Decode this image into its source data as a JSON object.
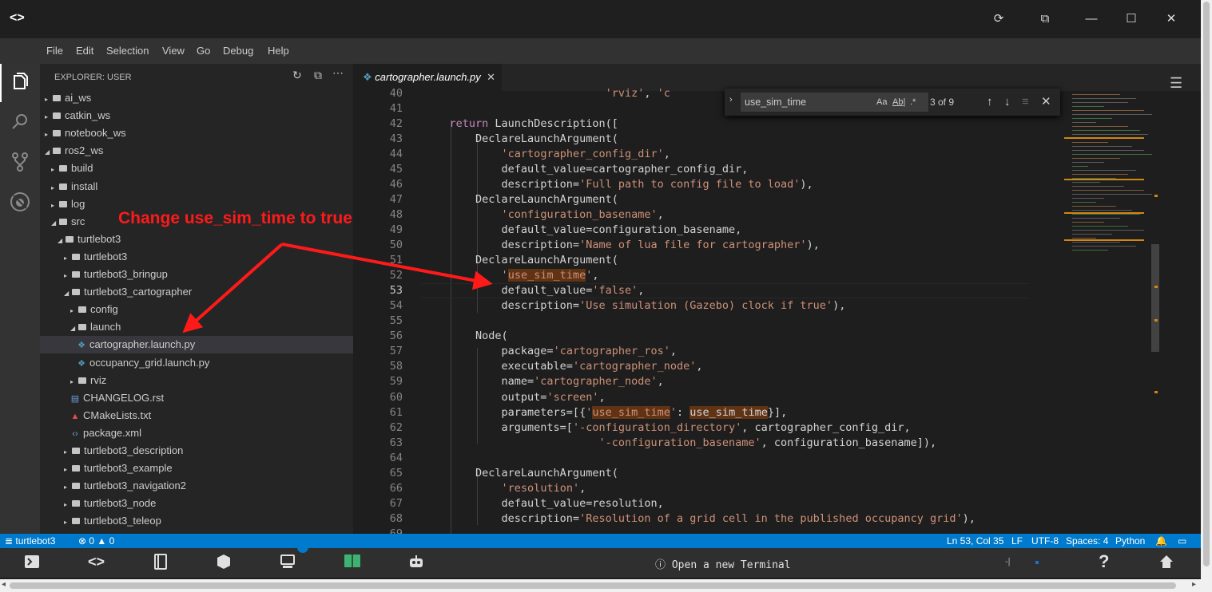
{
  "window": {
    "logo": "<>",
    "controls": [
      "⟳",
      "⧉",
      "—",
      "☐",
      "✕"
    ]
  },
  "menu": [
    "File",
    "Edit",
    "Selection",
    "View",
    "Go",
    "Debug",
    "Help"
  ],
  "sidebar": {
    "title": "EXPLORER: USER",
    "tree": [
      {
        "label": "ai_ws",
        "type": "folder",
        "depth": 0,
        "open": false
      },
      {
        "label": "catkin_ws",
        "type": "folder",
        "depth": 0,
        "open": false
      },
      {
        "label": "notebook_ws",
        "type": "folder",
        "depth": 0,
        "open": false
      },
      {
        "label": "ros2_ws",
        "type": "folder",
        "depth": 0,
        "open": true
      },
      {
        "label": "build",
        "type": "folder",
        "depth": 1,
        "open": false
      },
      {
        "label": "install",
        "type": "folder",
        "depth": 1,
        "open": false
      },
      {
        "label": "log",
        "type": "folder",
        "depth": 1,
        "open": false
      },
      {
        "label": "src",
        "type": "folder",
        "depth": 1,
        "open": true
      },
      {
        "label": "turtlebot3",
        "type": "folder",
        "depth": 2,
        "open": true
      },
      {
        "label": "turtlebot3",
        "type": "folder",
        "depth": 3,
        "open": false
      },
      {
        "label": "turtlebot3_bringup",
        "type": "folder",
        "depth": 3,
        "open": false
      },
      {
        "label": "turtlebot3_cartographer",
        "type": "folder",
        "depth": 3,
        "open": true
      },
      {
        "label": "config",
        "type": "folder",
        "depth": 4,
        "open": false
      },
      {
        "label": "launch",
        "type": "folder",
        "depth": 4,
        "open": true
      },
      {
        "label": "cartographer.launch.py",
        "type": "python",
        "depth": 5,
        "selected": true
      },
      {
        "label": "occupancy_grid.launch.py",
        "type": "python",
        "depth": 5
      },
      {
        "label": "rviz",
        "type": "folder",
        "depth": 4,
        "open": false
      },
      {
        "label": "CHANGELOG.rst",
        "type": "rst",
        "depth": 4
      },
      {
        "label": "CMakeLists.txt",
        "type": "cmake",
        "depth": 4
      },
      {
        "label": "package.xml",
        "type": "xml",
        "depth": 4
      },
      {
        "label": "turtlebot3_description",
        "type": "folder",
        "depth": 3,
        "open": false
      },
      {
        "label": "turtlebot3_example",
        "type": "folder",
        "depth": 3,
        "open": false
      },
      {
        "label": "turtlebot3_navigation2",
        "type": "folder",
        "depth": 3,
        "open": false
      },
      {
        "label": "turtlebot3_node",
        "type": "folder",
        "depth": 3,
        "open": false
      },
      {
        "label": "turtlebot3_teleop",
        "type": "folder",
        "depth": 3,
        "open": false
      }
    ]
  },
  "editor": {
    "tab": "cartographer.launch.py",
    "find": {
      "query": "use_sim_time",
      "count": "3 of 9"
    },
    "lines": [
      {
        "n": "40",
        "parts": [
          {
            "t": "                            "
          },
          {
            "t": "'rviz'",
            "c": "str"
          },
          {
            "t": ", "
          },
          {
            "t": "'c",
            "c": "str"
          }
        ]
      },
      {
        "n": "41",
        "parts": []
      },
      {
        "n": "42",
        "parts": [
          {
            "t": "    "
          },
          {
            "t": "return",
            "c": "kw"
          },
          {
            "t": " LaunchDescription(["
          }
        ]
      },
      {
        "n": "43",
        "parts": [
          {
            "t": "        DeclareLaunchArgument("
          }
        ]
      },
      {
        "n": "44",
        "parts": [
          {
            "t": "            "
          },
          {
            "t": "'cartographer_config_dir'",
            "c": "str"
          },
          {
            "t": ","
          }
        ]
      },
      {
        "n": "45",
        "parts": [
          {
            "t": "            default_value=cartographer_config_dir,"
          }
        ]
      },
      {
        "n": "46",
        "parts": [
          {
            "t": "            description="
          },
          {
            "t": "'Full path to config file to load'",
            "c": "str"
          },
          {
            "t": "),"
          }
        ]
      },
      {
        "n": "47",
        "parts": [
          {
            "t": "        DeclareLaunchArgument("
          }
        ]
      },
      {
        "n": "48",
        "parts": [
          {
            "t": "            "
          },
          {
            "t": "'configuration_basename'",
            "c": "str"
          },
          {
            "t": ","
          }
        ]
      },
      {
        "n": "49",
        "parts": [
          {
            "t": "            default_value=configuration_basename,"
          }
        ]
      },
      {
        "n": "50",
        "parts": [
          {
            "t": "            description="
          },
          {
            "t": "'Name of lua file for cartographer'",
            "c": "str"
          },
          {
            "t": "),"
          }
        ]
      },
      {
        "n": "51",
        "parts": [
          {
            "t": "        DeclareLaunchArgument("
          }
        ]
      },
      {
        "n": "52",
        "parts": [
          {
            "t": "            "
          },
          {
            "t": "'",
            "c": "str"
          },
          {
            "t": "use_sim_time",
            "c": "str hl"
          },
          {
            "t": "'",
            "c": "str"
          },
          {
            "t": ","
          }
        ]
      },
      {
        "n": "53",
        "parts": [
          {
            "t": "            default_value="
          },
          {
            "t": "'false'",
            "c": "str"
          },
          {
            "t": ","
          }
        ],
        "current": true
      },
      {
        "n": "54",
        "parts": [
          {
            "t": "            description="
          },
          {
            "t": "'Use simulation (Gazebo) clock if true'",
            "c": "str"
          },
          {
            "t": "),"
          }
        ]
      },
      {
        "n": "55",
        "parts": []
      },
      {
        "n": "56",
        "parts": [
          {
            "t": "        Node("
          }
        ]
      },
      {
        "n": "57",
        "parts": [
          {
            "t": "            package="
          },
          {
            "t": "'cartographer_ros'",
            "c": "str"
          },
          {
            "t": ","
          }
        ]
      },
      {
        "n": "58",
        "parts": [
          {
            "t": "            executable="
          },
          {
            "t": "'cartographer_node'",
            "c": "str"
          },
          {
            "t": ","
          }
        ]
      },
      {
        "n": "59",
        "parts": [
          {
            "t": "            name="
          },
          {
            "t": "'cartographer_node'",
            "c": "str"
          },
          {
            "t": ","
          }
        ]
      },
      {
        "n": "60",
        "parts": [
          {
            "t": "            output="
          },
          {
            "t": "'screen'",
            "c": "str"
          },
          {
            "t": ","
          }
        ]
      },
      {
        "n": "61",
        "parts": [
          {
            "t": "            parameters=[{"
          },
          {
            "t": "'",
            "c": "str"
          },
          {
            "t": "use_sim_time",
            "c": "str hl"
          },
          {
            "t": "'",
            "c": "str"
          },
          {
            "t": ": "
          },
          {
            "t": "use_sim_time",
            "c": "hl"
          },
          {
            "t": "}],"
          }
        ]
      },
      {
        "n": "62",
        "parts": [
          {
            "t": "            arguments=["
          },
          {
            "t": "'-configuration_directory'",
            "c": "str"
          },
          {
            "t": ", cartographer_config_dir,"
          }
        ]
      },
      {
        "n": "63",
        "parts": [
          {
            "t": "                           "
          },
          {
            "t": "'-configuration_basename'",
            "c": "str"
          },
          {
            "t": ", configuration_basename]),"
          }
        ]
      },
      {
        "n": "64",
        "parts": []
      },
      {
        "n": "65",
        "parts": [
          {
            "t": "        DeclareLaunchArgument("
          }
        ]
      },
      {
        "n": "66",
        "parts": [
          {
            "t": "            "
          },
          {
            "t": "'resolution'",
            "c": "str"
          },
          {
            "t": ","
          }
        ]
      },
      {
        "n": "67",
        "parts": [
          {
            "t": "            default_value=resolution,"
          }
        ]
      },
      {
        "n": "68",
        "parts": [
          {
            "t": "            description="
          },
          {
            "t": "'Resolution of a grid cell in the published occupancy grid'",
            "c": "str"
          },
          {
            "t": "),"
          }
        ]
      },
      {
        "n": "69",
        "parts": []
      }
    ]
  },
  "annotation": "Change use_sim_time to true",
  "status": {
    "branch": "turtlebot3",
    "errors": "0",
    "warnings": "0",
    "position": "Ln 53, Col 35",
    "eol": "LF",
    "encoding": "UTF-8",
    "spaces": "Spaces: 4",
    "language": "Python"
  },
  "dock": {
    "terminal_label": "Open a new Terminal",
    "small_text": "-|"
  },
  "colors": {
    "accent": "#007acc",
    "annotation": "#ff1a1a",
    "highlight": "#613315"
  }
}
